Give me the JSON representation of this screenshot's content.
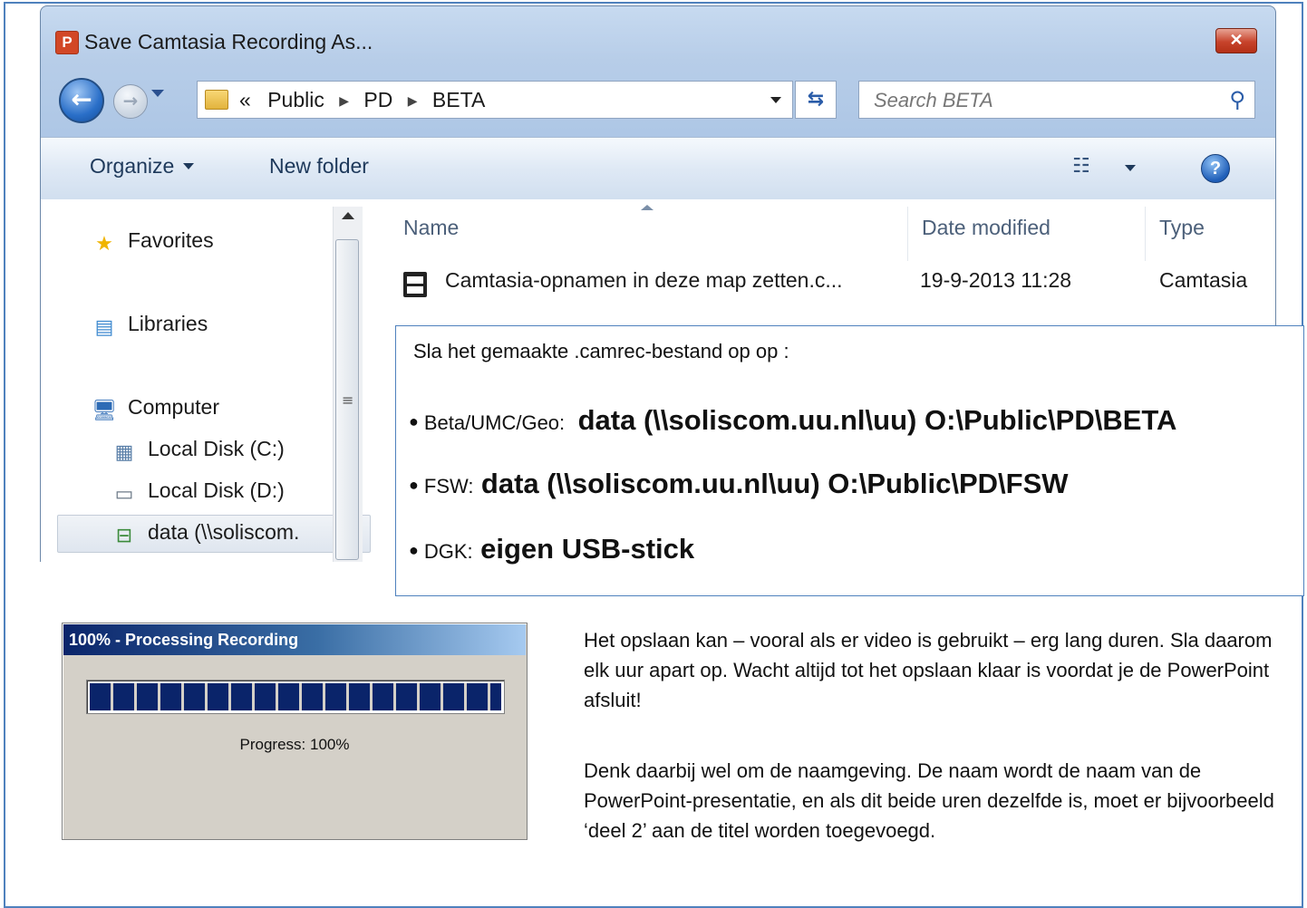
{
  "dialog": {
    "title": "Save Camtasia Recording As...",
    "app_icon_letter": "P",
    "close_glyph": "✕",
    "address": {
      "overflow": "«",
      "crumbs": [
        "Public",
        "PD",
        "BETA"
      ]
    },
    "search_placeholder": "Search BETA",
    "toolbar": {
      "organize_label": "Organize",
      "new_folder_label": "New folder"
    },
    "nav_pane": {
      "favorites": "Favorites",
      "libraries": "Libraries",
      "computer": "Computer",
      "local_disk_c": "Local Disk (C:)",
      "local_disk_d": "Local Disk (D:)",
      "network_drive": "data (\\\\soliscom."
    },
    "columns": {
      "name": "Name",
      "date_modified": "Date modified",
      "type": "Type"
    },
    "files": [
      {
        "name": "Camtasia-opnamen in deze map zetten.c...",
        "date_modified": "19-9-2013 11:28",
        "type": "Camtasia"
      }
    ]
  },
  "callout": {
    "intro": "Sla het gemaakte .camrec-bestand op op :",
    "items": [
      {
        "label": "Beta/UMC/Geo:",
        "value": "data (\\\\soliscom.uu.nl\\uu) O:\\Public\\PD\\BETA"
      },
      {
        "label": "FSW:",
        "value": "data (\\\\soliscom.uu.nl\\uu) O:\\Public\\PD\\FSW"
      },
      {
        "label": "DGK:",
        "value": "eigen USB-stick"
      }
    ]
  },
  "progress_window": {
    "title": "100% - Processing Recording",
    "progress": 1.0,
    "label": "Progress: 100%"
  },
  "body": {
    "paragraph_1": "Het opslaan kan – vooral als er video is gebruikt – erg lang duren. Sla daarom elk uur apart op. Wacht altijd tot het opslaan klaar is voordat je de PowerPoint afsluit!",
    "paragraph_2": "Denk daarbij wel om de naamgeving. De naam wordt de naam van de PowerPoint-presentatie, en als dit beide uren dezelfde is, moet er bijvoorbeeld ‘deel 2’ aan de titel worden toegevoegd."
  },
  "colors": {
    "frame_border": "#4f81bd",
    "progress_fill": "#0a246a"
  }
}
